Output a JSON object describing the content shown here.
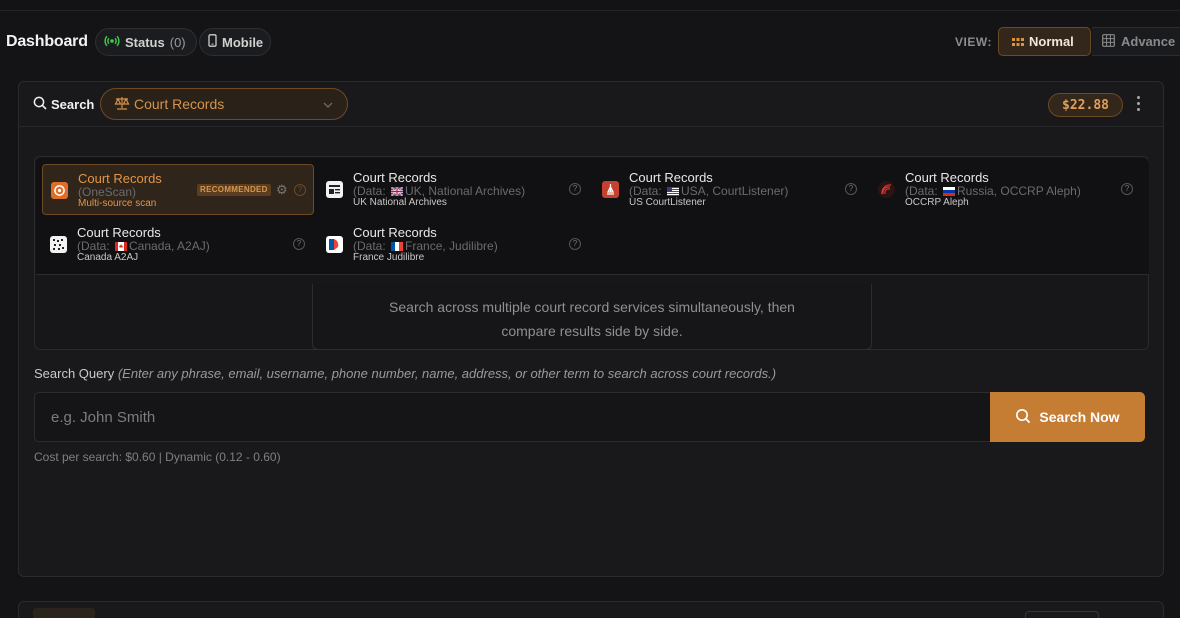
{
  "header": {
    "title": "Dashboard",
    "status_label": "Status",
    "status_count": "(0)",
    "mobile_label": "Mobile",
    "view_label": "VIEW:",
    "view_normal": "Normal",
    "view_advanced": "Advance"
  },
  "search": {
    "label": "Search",
    "selected_source": "Court Records",
    "balance": "$22.88"
  },
  "services": [
    {
      "title": "Court Records",
      "subtitle": "(OneScan)",
      "meta": "Multi-source scan",
      "badge": "RECOMMENDED",
      "selected": true
    },
    {
      "title": "Court Records",
      "subtitle_prefix": "(Data: ",
      "subtitle": "UK, National Archives)",
      "meta": "UK National Archives"
    },
    {
      "title": "Court Records",
      "subtitle_prefix": "(Data: ",
      "subtitle": "USA, CourtListener)",
      "meta": "US CourtListener"
    },
    {
      "title": "Court Records",
      "subtitle_prefix": "(Data: ",
      "subtitle": "Russia, OCCRP Aleph)",
      "meta": "OCCRP Aleph"
    },
    {
      "title": "Court Records",
      "subtitle_prefix": "(Data: ",
      "subtitle": "Canada, A2AJ)",
      "meta": "Canada A2AJ"
    },
    {
      "title": "Court Records",
      "subtitle_prefix": "(Data: ",
      "subtitle": "France, Judilibre)",
      "meta": "France Judilibre"
    }
  ],
  "description": {
    "line1": "Search across multiple court record services simultaneously, then",
    "line2": "compare results side by side."
  },
  "query": {
    "label": "Search Query",
    "hint": "(Enter any phrase, email, username, phone number, name, address, or other term to search across court records.)",
    "placeholder": "e.g. John Smith",
    "button": "Search Now",
    "cost": "Cost per search: $0.60 | Dynamic (0.12 - 0.60)"
  },
  "colors": {
    "accent": "#c57c33",
    "status_green": "#3ecf4a"
  }
}
